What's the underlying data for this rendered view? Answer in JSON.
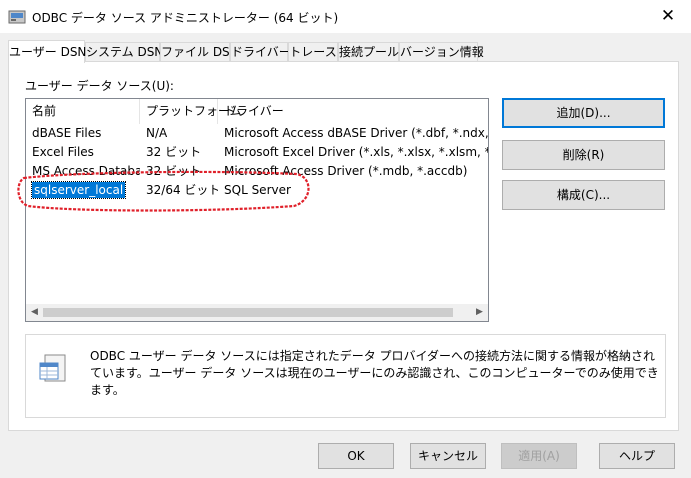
{
  "window": {
    "title": "ODBC データ ソース アドミニストレーター (64 ビット)",
    "close_glyph": "✕"
  },
  "tabs": [
    {
      "label": "ユーザー DSN"
    },
    {
      "label": "システム DSN"
    },
    {
      "label": "ファイル DSN"
    },
    {
      "label": "ドライバー"
    },
    {
      "label": "トレース"
    },
    {
      "label": "接続プール"
    },
    {
      "label": "バージョン情報"
    }
  ],
  "panel": {
    "group_label": "ユーザー データ ソース(U):"
  },
  "list": {
    "columns": [
      "名前",
      "プラットフォーム",
      "ドライバー"
    ],
    "rows": [
      {
        "name": "dBASE Files",
        "platform": "N/A",
        "driver": "Microsoft Access dBASE Driver (*.dbf, *.ndx, *.mdx)"
      },
      {
        "name": "Excel Files",
        "platform": "32 ビット",
        "driver": "Microsoft Excel Driver (*.xls, *.xlsx, *.xlsm, *.xlsb)"
      },
      {
        "name": "MS Access Database",
        "platform": "32 ビット",
        "driver": "Microsoft Access Driver (*.mdb, *.accdb)"
      },
      {
        "name": "sqlserver_local",
        "platform": "32/64 ビット",
        "driver": "SQL Server"
      }
    ],
    "selected_index": 3
  },
  "buttons": {
    "add": "追加(D)...",
    "remove": "削除(R)",
    "configure": "構成(C)..."
  },
  "info": {
    "text": "ODBC ユーザー データ ソースには指定されたデータ プロバイダーへの接続方法に関する情報が格納されています。ユーザー データ ソースは現在のユーザーにのみ認識され、このコンピューターでのみ使用できます。"
  },
  "footer": {
    "ok": "OK",
    "cancel": "キャンセル",
    "apply": "適用(A)",
    "help": "ヘルプ"
  },
  "colors": {
    "selection": "#0078d7",
    "annotation": "#e0202a"
  }
}
